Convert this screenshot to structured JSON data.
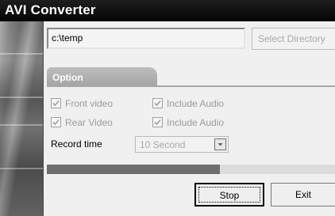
{
  "window": {
    "title": "AVI Converter"
  },
  "directory": {
    "path_value": "c:\\temp",
    "select_button_label": "Select Directory"
  },
  "options": {
    "tab_label": "Option",
    "front_video": {
      "label": "Front video",
      "checked": true,
      "enabled": false
    },
    "front_audio": {
      "label": "Include Audio",
      "checked": true,
      "enabled": false
    },
    "rear_video": {
      "label": "Rear Video",
      "checked": true,
      "enabled": false
    },
    "rear_audio": {
      "label": "Include Audio",
      "checked": true,
      "enabled": false
    },
    "record_time_label": "Record time",
    "record_time_value": "10 Second"
  },
  "progress": {
    "fraction": 0.6
  },
  "buttons": {
    "stop_label": "Stop",
    "exit_label": "Exit"
  }
}
